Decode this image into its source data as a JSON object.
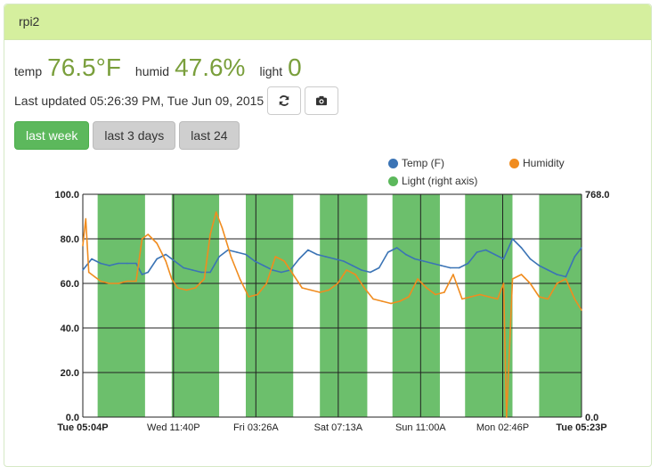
{
  "panel": {
    "title": "rpi2"
  },
  "readings": {
    "temp_label": "temp",
    "temp_value": "76.5°F",
    "humid_label": "humid",
    "humid_value": "47.6%",
    "light_label": "light",
    "light_value": "0"
  },
  "status": {
    "last_updated": "Last updated 05:26:39 PM, Tue Jun 09, 2015"
  },
  "icons": {
    "refresh": "refresh-icon",
    "snapshot": "camera-icon"
  },
  "range_buttons": [
    {
      "label": "last week",
      "active": true
    },
    {
      "label": "last 3 days",
      "active": false
    },
    {
      "label": "last 24",
      "active": false
    }
  ],
  "colors": {
    "temp": "#3b74b5",
    "humidity": "#f08c1f",
    "light": "#5cb85c",
    "accent": "#7a9f3c",
    "header": "#d5ef9e"
  },
  "chart_data": {
    "type": "line",
    "legend": [
      "Temp (F)",
      "Humidity",
      "Light (right axis)"
    ],
    "legend_position": "top-right",
    "grid": true,
    "y_left": {
      "ylim": [
        0,
        100
      ],
      "ticks": [
        "0.0",
        "20.0",
        "40.0",
        "60.0",
        "80.0",
        "100.0"
      ]
    },
    "y_right": {
      "ylim": [
        0,
        768
      ],
      "ticks": [
        "0.0",
        "768.0"
      ]
    },
    "x_ticks": [
      "Tue 05:04P",
      "Wed 11:40P",
      "Fri 03:26A",
      "Sat 07:13A",
      "Sun 11:00A",
      "Mon 02:46P",
      "Tue 05:23P"
    ],
    "x_tick_hours": [
      0,
      30.6,
      58.4,
      86.2,
      114,
      141.7,
      168.3
    ],
    "light_on_intervals_hours": [
      [
        5,
        21
      ],
      [
        30,
        46
      ],
      [
        55,
        71
      ],
      [
        80,
        96
      ],
      [
        104.5,
        120.5
      ],
      [
        129,
        145
      ],
      [
        154,
        170
      ]
    ],
    "light_value_when_on": 768,
    "series": [
      {
        "name": "Temp (F)",
        "x": [
          0,
          3,
          6,
          9,
          12,
          15,
          18,
          20,
          22,
          25,
          28,
          31,
          34,
          37,
          40,
          43,
          46,
          49,
          52,
          55,
          58,
          61,
          64,
          67,
          70,
          73,
          76,
          79,
          82,
          85,
          88,
          91,
          94,
          97,
          100,
          103,
          106,
          109,
          112,
          115,
          118,
          121,
          124,
          127,
          130,
          133,
          136,
          139,
          142,
          145,
          148,
          151,
          154,
          157,
          160,
          163,
          166,
          168.3
        ],
        "values": [
          66,
          71,
          69,
          68,
          69,
          69,
          69,
          64,
          65,
          71,
          73,
          70,
          67,
          66,
          65,
          65,
          72,
          75,
          74,
          73,
          70,
          68,
          66,
          65,
          66,
          71,
          75,
          73,
          72,
          71,
          70,
          68,
          66,
          65,
          67,
          74,
          76,
          73,
          71,
          70,
          69,
          68,
          67,
          67,
          69,
          74,
          75,
          73,
          71,
          80,
          76,
          71,
          68,
          66,
          64,
          63,
          72,
          76
        ]
      },
      {
        "name": "Humidity",
        "x": [
          0,
          1,
          2,
          4,
          6,
          9,
          12,
          15,
          18,
          20,
          22,
          25,
          28,
          30,
          32,
          35,
          38,
          41,
          43,
          45,
          47,
          50,
          53,
          56,
          59,
          62,
          65,
          68,
          71,
          74,
          77,
          80,
          83,
          86,
          89,
          92,
          95,
          98,
          101,
          104,
          107,
          110,
          113,
          116,
          119,
          122,
          125,
          128,
          131,
          134,
          137,
          140,
          142,
          143,
          145,
          148,
          151,
          154,
          157,
          160,
          163,
          166,
          168.3
        ],
        "values": [
          77,
          89,
          65,
          63,
          61,
          60,
          60,
          61,
          61,
          80,
          82,
          78,
          70,
          62,
          58,
          57,
          58,
          62,
          82,
          92,
          85,
          72,
          62,
          54,
          55,
          60,
          72,
          70,
          64,
          58,
          57,
          56,
          57,
          60,
          66,
          64,
          58,
          53,
          52,
          51,
          52,
          54,
          62,
          58,
          55,
          56,
          64,
          53,
          54,
          55,
          54,
          53,
          60,
          0,
          62,
          64,
          60,
          54,
          53,
          60,
          62,
          53,
          48
        ]
      }
    ]
  }
}
